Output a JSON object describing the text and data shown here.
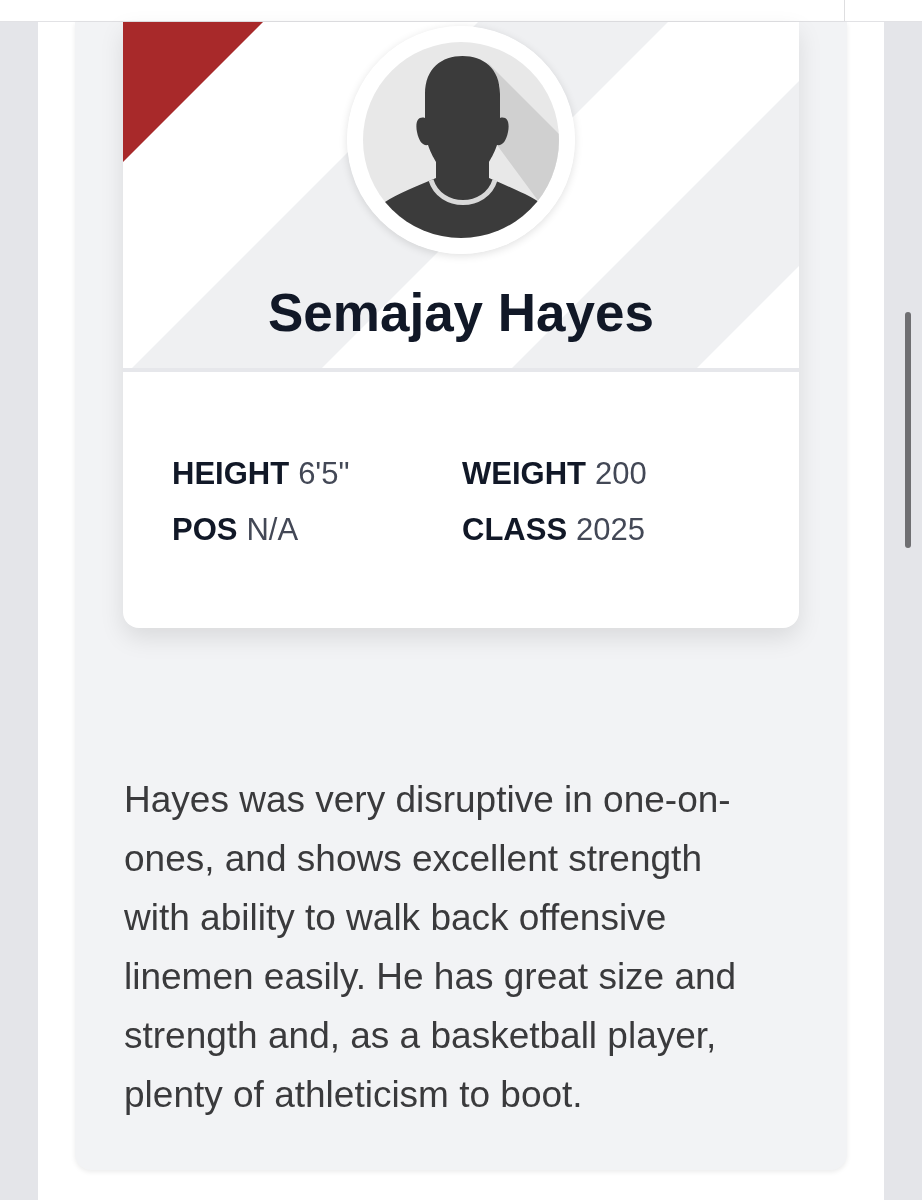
{
  "player": {
    "name": "Semajay Hayes",
    "stats": [
      {
        "label": "HEIGHT",
        "value": "6'5\""
      },
      {
        "label": "WEIGHT",
        "value": "200"
      },
      {
        "label": "POS",
        "value": "N/A"
      },
      {
        "label": "CLASS",
        "value": "2025"
      }
    ]
  },
  "description": "Hayes was very disruptive in one-on-ones, and shows excellent strength with ability to walk back offensive linemen easily. He has great size and strength and, as a basketball player, plenty of athleticism to boot."
}
